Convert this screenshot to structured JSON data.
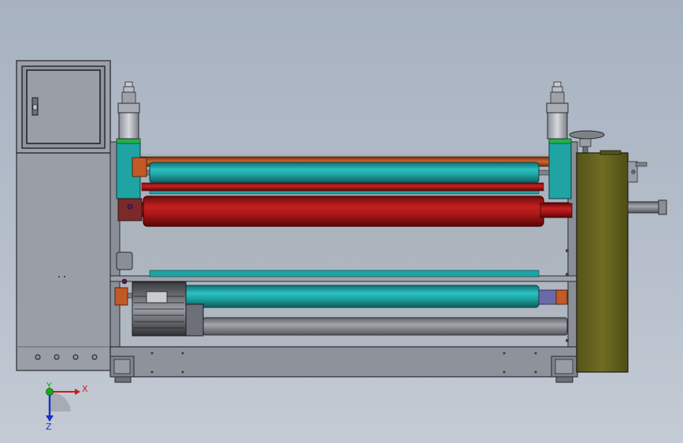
{
  "window": {
    "background_top": "#a7b2c1",
    "background_bottom": "#c4cbd5"
  },
  "model": {
    "frame_color": "#8f939c",
    "frame_edge": "#2a2c30",
    "cabinet_color": "#9a9ea7",
    "teal_roller_color": "#1fa3a3",
    "red_roller_color": "#b21a1a",
    "orange_roller_color": "#c25a25",
    "gray_roller_color": "#8a8c92",
    "gearbox_color": "#6e6a1e",
    "green_band_color": "#23b04a"
  },
  "triad": {
    "x_label": "X",
    "y_label": "Y",
    "z_label": "Z",
    "x_color": "#d01818",
    "y_color": "#18a418",
    "z_color": "#1830c8"
  }
}
